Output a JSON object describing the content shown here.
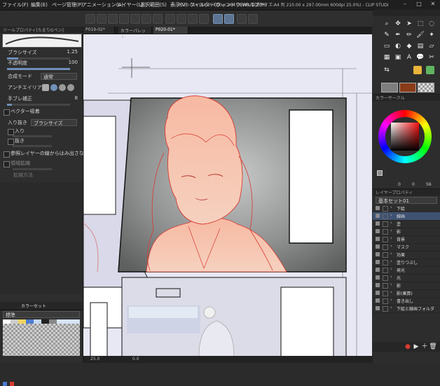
{
  "menu": [
    "ファイル(F)",
    "編集(E)",
    "ページ管理(P)",
    "アニメーション(A)",
    "レイヤー(L)",
    "選択範囲(S)",
    "表示(V)",
    "フィルター(I)",
    "ウィンドウ(W)",
    "ヘルプ(H)"
  ],
  "window_title": "P020-01* (B4 257.00 x 364.00mm 製本サイズ:A4 判 210.00 x 297.00mm 600dpi 25.0%) - CLIP STUDIO PAINT EX",
  "document_tabs": [
    "P019-02*",
    "カラーパレット",
    "P020-01*"
  ],
  "tool_property": {
    "header": "ツールプロパティ[たまりGペン]",
    "brush_size_label": "ブラシサイズ",
    "brush_size_value": "1.25",
    "opacity_label": "不透明度",
    "opacity_value": "100",
    "blend_mode_label": "合成モード",
    "blend_mode_value": "通常",
    "antialias_label": "アンチエイリアス",
    "stabilization_label": "手ブレ補正",
    "stabilization_value": "8",
    "vector_label": "ベクター吸着",
    "taper_in_label": "入り抜き",
    "taper_in_value": "ブラシサイズ",
    "taper_start_label": "入り",
    "taper_end_label": "抜き",
    "ref_layer_label": "参照レイヤーの線からはみ出さない",
    "expand_label": "領域拡縮",
    "expand_method_label": "拡縮方法"
  },
  "color_set": {
    "tabs": [
      "カラーセット"
    ],
    "set_name": "標準"
  },
  "color_wheel": {
    "header": "カラーサークル",
    "readout_h": "0",
    "readout_s": "0",
    "readout_v": "56"
  },
  "layer_panel": {
    "header": "レイヤープロパティ",
    "set_name": "基本セット01",
    "layers": [
      "下絵",
      "線画",
      "塗",
      "影",
      "背景",
      "マスク",
      "効果",
      "塗りつぶし",
      "発光",
      "光",
      "影",
      "影(乗算)",
      "書き出し",
      "下絵と線画フォルダ"
    ],
    "selected_index": 1
  },
  "status": {
    "zoom": "25.0",
    "value2": "0.0"
  },
  "colors": {
    "accent": "#5c7391",
    "figure_skin": "#f4c4ac",
    "lineart_red": "#d83a30"
  }
}
